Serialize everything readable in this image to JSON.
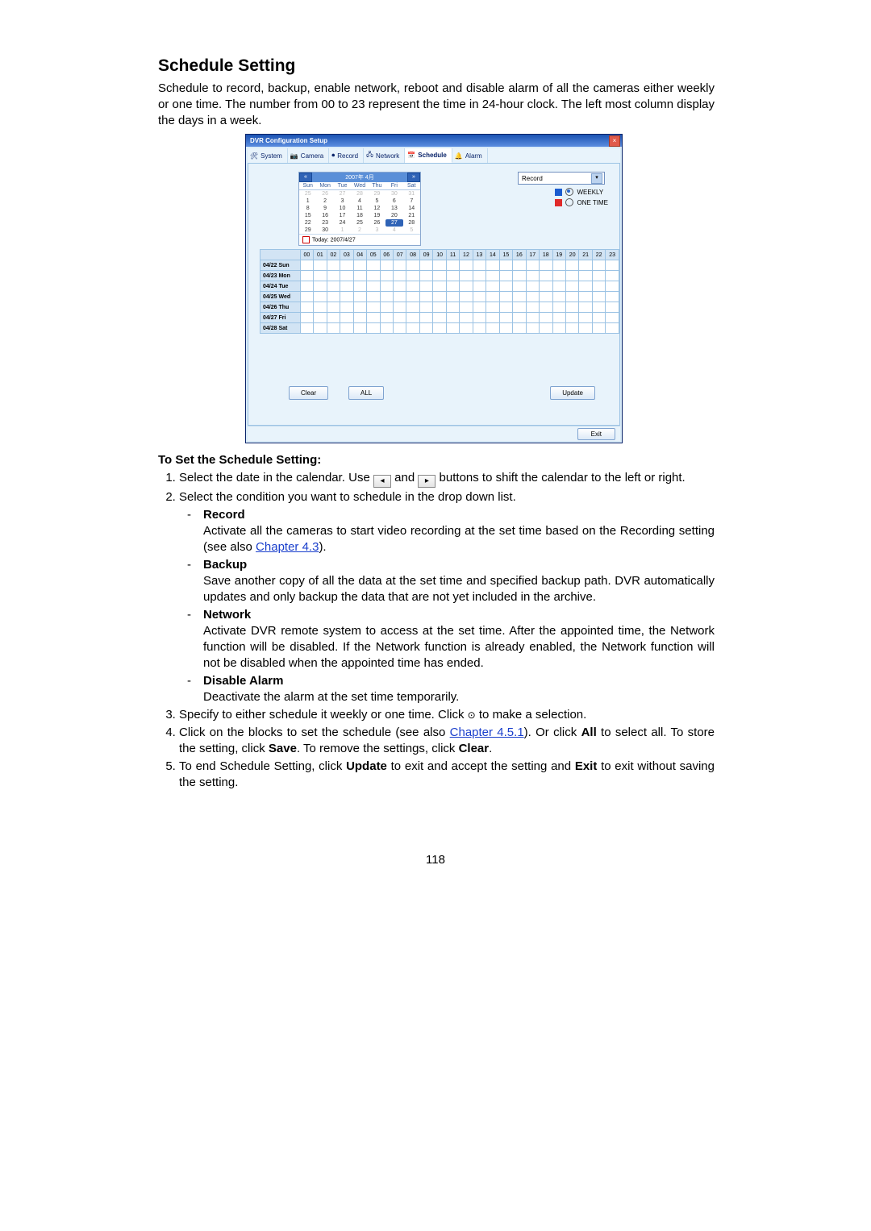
{
  "page_number": "118",
  "heading": "Schedule Setting",
  "intro": "Schedule to record, backup, enable network, reboot and disable alarm of all the cameras either weekly or one time. The number from 00 to 23 represent the time in 24-hour clock. The left most column display the days in a week.",
  "dialog": {
    "title": "DVR Configuration Setup",
    "close_glyph": "×",
    "tabs": {
      "system": "System",
      "camera": "Camera",
      "record": "Record",
      "network": "Network",
      "schedule": "Schedule",
      "alarm": "Alarm"
    },
    "calendar": {
      "month_label": "2007年 4月",
      "prev_glyph": "«",
      "next_glyph": "»",
      "dow": [
        "Sun",
        "Mon",
        "Tue",
        "Wed",
        "Thu",
        "Fri",
        "Sat"
      ],
      "grid": [
        {
          "v": "25",
          "dim": true
        },
        {
          "v": "26",
          "dim": true
        },
        {
          "v": "27",
          "dim": true
        },
        {
          "v": "28",
          "dim": true
        },
        {
          "v": "29",
          "dim": true
        },
        {
          "v": "30",
          "dim": true
        },
        {
          "v": "31",
          "dim": true
        },
        {
          "v": "1"
        },
        {
          "v": "2"
        },
        {
          "v": "3"
        },
        {
          "v": "4"
        },
        {
          "v": "5"
        },
        {
          "v": "6"
        },
        {
          "v": "7"
        },
        {
          "v": "8"
        },
        {
          "v": "9"
        },
        {
          "v": "10"
        },
        {
          "v": "11"
        },
        {
          "v": "12"
        },
        {
          "v": "13"
        },
        {
          "v": "14"
        },
        {
          "v": "15"
        },
        {
          "v": "16"
        },
        {
          "v": "17"
        },
        {
          "v": "18"
        },
        {
          "v": "19"
        },
        {
          "v": "20"
        },
        {
          "v": "21"
        },
        {
          "v": "22"
        },
        {
          "v": "23"
        },
        {
          "v": "24"
        },
        {
          "v": "25"
        },
        {
          "v": "26"
        },
        {
          "v": "27",
          "sel": true
        },
        {
          "v": "28"
        },
        {
          "v": "29"
        },
        {
          "v": "30"
        },
        {
          "v": "1",
          "dim": true
        },
        {
          "v": "2",
          "dim": true
        },
        {
          "v": "3",
          "dim": true
        },
        {
          "v": "4",
          "dim": true
        },
        {
          "v": "5",
          "dim": true
        }
      ],
      "today_label": "Today: 2007/4/27"
    },
    "dropdown": {
      "selected": "Record",
      "chevron": "▾"
    },
    "legend": {
      "weekly": "WEEKLY",
      "onetime": "ONE TIME"
    },
    "hours": [
      "00",
      "01",
      "02",
      "03",
      "04",
      "05",
      "06",
      "07",
      "08",
      "09",
      "10",
      "11",
      "12",
      "13",
      "14",
      "15",
      "16",
      "17",
      "18",
      "19",
      "20",
      "21",
      "22",
      "23"
    ],
    "days": [
      "04/22 Sun",
      "04/23 Mon",
      "04/24 Tue",
      "04/25 Wed",
      "04/26 Thu",
      "04/27 Fri",
      "04/28 Sat"
    ],
    "buttons": {
      "clear": "Clear",
      "all": "ALL",
      "update": "Update",
      "exit": "Exit"
    }
  },
  "instructions": {
    "header": "To Set the Schedule Setting:",
    "step1_a": "Select the date in the calendar. Use ",
    "step1_b": " and ",
    "step1_c": " buttons to shift the calendar to the left or right.",
    "arrow_left": "◂",
    "arrow_right": "▸",
    "step2": "Select the condition you want to schedule in the drop down list.",
    "sub": {
      "record_h": "Record",
      "record_b_a": "Activate all the cameras to start video recording at the set time based on the Recording setting (see also ",
      "record_link": "Chapter 4.3",
      "record_b_b": ").",
      "backup_h": "Backup",
      "backup_b": "Save another copy of all the data at the set time and specified backup path. DVR automatically updates and only backup the data that are not yet included in the archive.",
      "network_h": "Network",
      "network_b": "Activate DVR remote system to access at the set time. After the appointed time, the Network function will be disabled. If the Network function is already enabled, the Network function will not be disabled when the appointed time has ended.",
      "disable_h": "Disable Alarm",
      "disable_b": "Deactivate the alarm at the set time temporarily."
    },
    "step3_a": "Specify to either schedule it weekly or one time. Click ",
    "radio_glyph": "⊙",
    "step3_b": " to make a selection.",
    "step4_a": "Click on the blocks to set the schedule (see also ",
    "step4_link": " Chapter 4.5.1",
    "step4_b": "). Or click ",
    "step4_all": "All",
    "step4_c": " to select all. To store the setting, click ",
    "step4_save": "Save",
    "step4_d": ". To remove the settings, click ",
    "step4_clear": "Clear",
    "step4_e": ".",
    "step5_a": "To end Schedule Setting, click ",
    "step5_update": "Update",
    "step5_b": " to exit and accept the setting and ",
    "step5_exit": "Exit",
    "step5_c": " to exit without saving the setting."
  }
}
